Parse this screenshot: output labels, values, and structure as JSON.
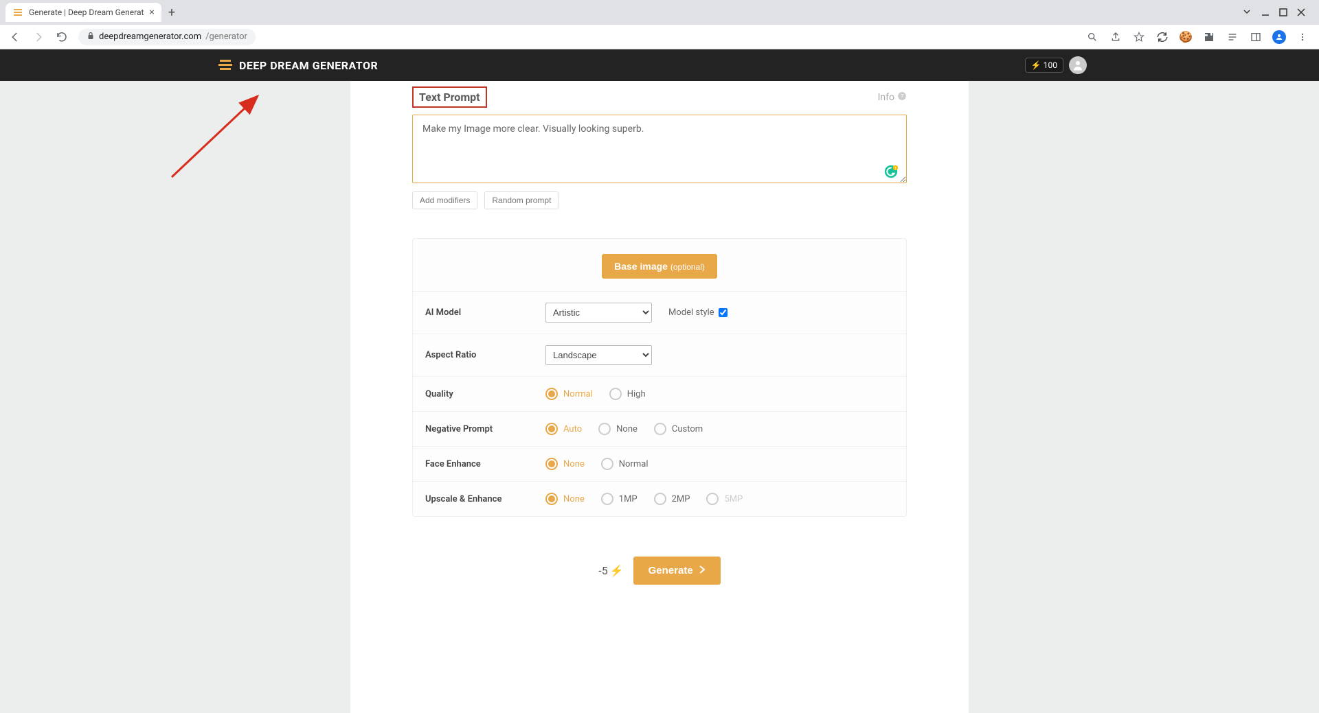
{
  "browser": {
    "tab_title": "Generate | Deep Dream Generat",
    "url_host": "deepdreamgenerator.com",
    "url_path": "/generator"
  },
  "header": {
    "brand": "DEEP DREAM GENERATOR",
    "energy_value": "100"
  },
  "prompt": {
    "section_title": "Text Prompt",
    "info_label": "Info",
    "text_value": "Make my Image more clear. Visually looking superb.",
    "add_modifiers_label": "Add modifiers",
    "random_prompt_label": "Random prompt"
  },
  "base_image": {
    "button_label": "Base image",
    "optional_label": "(optional)"
  },
  "options": {
    "ai_model": {
      "label": "AI Model",
      "selected": "Artistic",
      "model_style_label": "Model style",
      "model_style_checked": true
    },
    "aspect_ratio": {
      "label": "Aspect Ratio",
      "selected": "Landscape"
    },
    "quality": {
      "label": "Quality",
      "options": [
        "Normal",
        "High"
      ],
      "selected": "Normal"
    },
    "negative_prompt": {
      "label": "Negative Prompt",
      "options": [
        "Auto",
        "None",
        "Custom"
      ],
      "selected": "Auto"
    },
    "face_enhance": {
      "label": "Face Enhance",
      "options": [
        "None",
        "Normal"
      ],
      "selected": "None"
    },
    "upscale": {
      "label": "Upscale & Enhance",
      "options": [
        "None",
        "1MP",
        "2MP",
        "5MP"
      ],
      "selected": "None",
      "disabled": [
        "5MP"
      ]
    }
  },
  "generate": {
    "cost": "-5",
    "button_label": "Generate"
  }
}
